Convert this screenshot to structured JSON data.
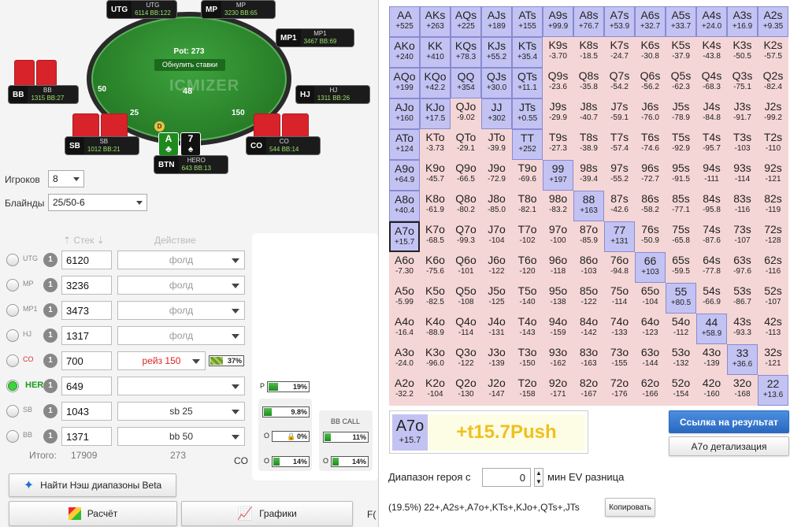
{
  "table": {
    "pot": "Pot: 273",
    "reset": "Обнулить ставки",
    "watermark": "ICMIZER",
    "pot_chips": "48",
    "seats": [
      {
        "pos": "UTG",
        "name": "UTG",
        "stack": "6114 BB:122"
      },
      {
        "pos": "MP",
        "name": "MP",
        "stack": "3230 BB:65"
      },
      {
        "pos": "MP1",
        "name": "MP1",
        "stack": "3467 BB:69"
      },
      {
        "pos": "BB",
        "name": "BB",
        "stack": "1315 BB:27"
      },
      {
        "pos": "HJ",
        "name": "HJ",
        "stack": "1311 BB:26"
      },
      {
        "pos": "SB",
        "name": "SB",
        "stack": "1012 BB:21"
      },
      {
        "pos": "CO",
        "name": "CO",
        "stack": "544 BB:14"
      },
      {
        "pos": "BTN",
        "name": "HERO",
        "stack": "643 BB:13"
      }
    ],
    "chip_bb": "50",
    "chip_sb": "25",
    "chip_co": "150",
    "dealer": "D",
    "hero_cards": [
      {
        "rank": "A",
        "suit": "♣"
      },
      {
        "rank": "7",
        "suit": "♠"
      }
    ]
  },
  "settings": {
    "players_label": "Игроков",
    "players_value": "8",
    "blinds_label": "Блайнды",
    "blinds_value": "25/50-6"
  },
  "players_header": {
    "stack": "Стек",
    "action": "Действие"
  },
  "players": [
    {
      "pos": "UTG",
      "num": "1",
      "stack": "6120",
      "action": "фолд",
      "selected": false
    },
    {
      "pos": "MP",
      "num": "1",
      "stack": "3236",
      "action": "фолд",
      "selected": false
    },
    {
      "pos": "MP1",
      "num": "1",
      "stack": "3473",
      "action": "фолд",
      "selected": false
    },
    {
      "pos": "HJ",
      "num": "1",
      "stack": "1317",
      "action": "фолд",
      "selected": false
    },
    {
      "pos": "CO",
      "num": "1",
      "stack": "700",
      "action": "рейз 150",
      "selected": false,
      "pct": "37%"
    },
    {
      "pos": "HERO",
      "num": "1",
      "stack": "649",
      "action": "",
      "selected": true
    },
    {
      "pos": "SB",
      "num": "1",
      "stack": "1043",
      "action": "sb 25",
      "selected": false
    },
    {
      "pos": "BB",
      "num": "1",
      "stack": "1371",
      "action": "bb 50",
      "selected": false
    }
  ],
  "totals": {
    "label": "Итого:",
    "stack": "17909",
    "action": "273"
  },
  "tree": {
    "p_label": "P",
    "p_pct": "19%",
    "sb_pct": "9.8%",
    "o1_label": "O",
    "o1_pct": "0%",
    "o2_label": "O",
    "o2_pct": "14%",
    "bbcall_label": "BB CALL",
    "bbcall_pct": "11%",
    "o3_label": "O",
    "o3_pct": "14%",
    "co_label": "CO"
  },
  "buttons": {
    "nash": "Найти Нэш диапазоны Beta",
    "calc": "Расчёт",
    "graphs": "Графики",
    "extra": "F("
  },
  "result": {
    "hand": "A7o",
    "ev": "+15.7",
    "label": "+t15.7Push",
    "link_btn": "Ссылка на результат",
    "detail_btn": "A7o детализация"
  },
  "hero_range": {
    "label": "Диапазон героя с",
    "value": "0",
    "suffix": "мин EV разница",
    "summary": "(19.5%) 22+,A2s+,A7o+,KTs+,KJo+,QTs+,JTs",
    "copy": "Копировать"
  },
  "grid": [
    [
      "AA|+525|p",
      "AKs|+263|p",
      "AQs|+225|p",
      "AJs|+189|p",
      "ATs|+155|p",
      "A9s|+99.9|p",
      "A8s|+76.7|p",
      "A7s|+53.9|p",
      "A6s|+32.7|p",
      "A5s|+33.7|p",
      "A4s|+24.0|p",
      "A3s|+16.9|p",
      "A2s|+9.35|p"
    ],
    [
      "AKo|+240|p",
      "KK|+410|p",
      "KQs|+78.3|p",
      "KJs|+55.2|p",
      "KTs|+35.4|p",
      "K9s|-3.70|n",
      "K8s|-18.5|n",
      "K7s|-24.7|n",
      "K6s|-30.8|n",
      "K5s|-37.9|n",
      "K4s|-43.8|n",
      "K3s|-50.5|n",
      "K2s|-57.5|n"
    ],
    [
      "AQo|+199|p",
      "KQo|+42.2|p",
      "QQ|+354|p",
      "QJs|+30.0|p",
      "QTs|+11.1|p",
      "Q9s|-23.6|n",
      "Q8s|-35.8|n",
      "Q7s|-54.2|n",
      "Q6s|-56.2|n",
      "Q5s|-62.3|n",
      "Q4s|-68.3|n",
      "Q3s|-75.1|n",
      "Q2s|-82.4|n"
    ],
    [
      "AJo|+160|p",
      "KJo|+17.5|p",
      "QJo|-9.02|n",
      "JJ|+302|p",
      "JTs|+0.55|p",
      "J9s|-29.9|n",
      "J8s|-40.7|n",
      "J7s|-59.1|n",
      "J6s|-76.0|n",
      "J5s|-78.9|n",
      "J4s|-84.8|n",
      "J3s|-91.7|n",
      "J2s|-99.2|n"
    ],
    [
      "ATo|+124|p",
      "KTo|-3.73|n",
      "QTo|-29.1|n",
      "JTo|-39.9|n",
      "TT|+252|p",
      "T9s|-27.3|n",
      "T8s|-38.9|n",
      "T7s|-57.4|n",
      "T6s|-74.6|n",
      "T5s|-92.9|n",
      "T4s|-95.7|n",
      "T3s|-103|n",
      "T2s|-110|n"
    ],
    [
      "A9o|+64.9|p",
      "K9o|-45.7|n",
      "Q9o|-66.5|n",
      "J9o|-72.9|n",
      "T9o|-69.6|n",
      "99|+197|p",
      "98s|-39.4|n",
      "97s|-55.2|n",
      "96s|-72.7|n",
      "95s|-91.5|n",
      "94s|-111|n",
      "93s|-114|n",
      "92s|-121|n"
    ],
    [
      "A8o|+40.4|p",
      "K8o|-61.9|n",
      "Q8o|-80.2|n",
      "J8o|-85.0|n",
      "T8o|-82.1|n",
      "98o|-83.2|n",
      "88|+163|p",
      "87s|-42.6|n",
      "86s|-58.2|n",
      "85s|-77.1|n",
      "84s|-95.8|n",
      "83s|-116|n",
      "82s|-119|n"
    ],
    [
      "A7o|+15.7|s",
      "K7o|-68.5|n",
      "Q7o|-99.3|n",
      "J7o|-104|n",
      "T7o|-102|n",
      "97o|-100|n",
      "87o|-85.9|n",
      "77|+131|p",
      "76s|-50.9|n",
      "75s|-65.8|n",
      "74s|-87.6|n",
      "73s|-107|n",
      "72s|-128|n"
    ],
    [
      "A6o|-7.30|n",
      "K6o|-75.6|n",
      "Q6o|-101|n",
      "J6o|-122|n",
      "T6o|-120|n",
      "96o|-118|n",
      "86o|-103|n",
      "76o|-94.8|n",
      "66|+103|p",
      "65s|-59.5|n",
      "64s|-77.8|n",
      "63s|-97.6|n",
      "62s|-116|n"
    ],
    [
      "A5o|-5.99|n",
      "K5o|-82.5|n",
      "Q5o|-108|n",
      "J5o|-125|n",
      "T5o|-140|n",
      "95o|-138|n",
      "85o|-122|n",
      "75o|-114|n",
      "65o|-104|n",
      "55|+80.5|p",
      "54s|-66.9|n",
      "53s|-86.7|n",
      "52s|-107|n"
    ],
    [
      "A4o|-16.4|n",
      "K4o|-88.9|n",
      "Q4o|-114|n",
      "J4o|-131|n",
      "T4o|-143|n",
      "94o|-159|n",
      "84o|-142|n",
      "74o|-133|n",
      "64o|-123|n",
      "54o|-112|n",
      "44|+58.9|p",
      "43s|-93.3|n",
      "42s|-113|n"
    ],
    [
      "A3o|-24.0|n",
      "K3o|-96.0|n",
      "Q3o|-122|n",
      "J3o|-139|n",
      "T3o|-150|n",
      "93o|-162|n",
      "83o|-163|n",
      "73o|-155|n",
      "63o|-144|n",
      "53o|-132|n",
      "43o|-139|n",
      "33|+36.6|p",
      "32s|-121|n"
    ],
    [
      "A2o|-32.2|n",
      "K2o|-104|n",
      "Q2o|-130|n",
      "J2o|-147|n",
      "T2o|-158|n",
      "92o|-171|n",
      "82o|-167|n",
      "72o|-176|n",
      "62o|-166|n",
      "52o|-154|n",
      "42o|-160|n",
      "32o|-168|n",
      "22|+13.6|p"
    ]
  ]
}
